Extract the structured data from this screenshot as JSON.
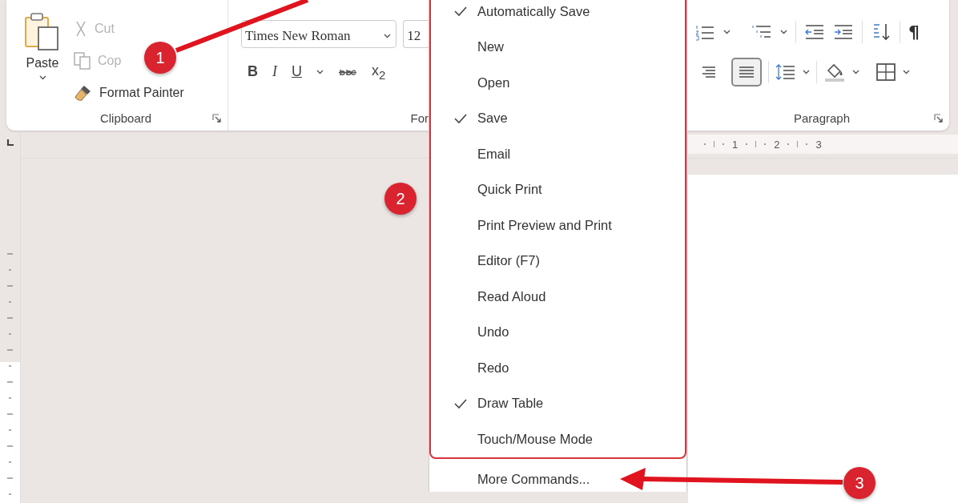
{
  "ribbon": {
    "clipboard": {
      "label": "Clipboard",
      "paste": {
        "label": "Paste"
      },
      "commands": [
        {
          "kind": "cut",
          "label": "Cut",
          "disabled": true
        },
        {
          "kind": "copy",
          "label": "Cop",
          "disabled": true
        },
        {
          "kind": "painter",
          "label": "Format Painter",
          "disabled": false
        }
      ]
    },
    "font": {
      "label": "For",
      "font_name": "Times New Roman",
      "font_size": "12",
      "buttons": [
        {
          "kind": "bold",
          "text": "B"
        },
        {
          "kind": "italic",
          "text": "I"
        },
        {
          "kind": "underline",
          "text": "U"
        },
        {
          "kind": "strike"
        },
        {
          "kind": "subscript",
          "text": "x$_{2}$"
        }
      ]
    },
    "paragraph": {
      "label": "Paragraph",
      "pilcrow": "¶",
      "alignment": [
        {
          "selected": false
        },
        {
          "selected": true
        }
      ]
    }
  },
  "ruler": {
    "marks": [
      "1",
      "2",
      "3"
    ]
  },
  "quick_access_menu": {
    "items": [
      {
        "label": "Automatically Save",
        "checked": true
      },
      {
        "label": "New",
        "checked": false
      },
      {
        "label": "Open",
        "checked": false
      },
      {
        "label": "Save",
        "checked": true
      },
      {
        "label": "Email",
        "checked": false
      },
      {
        "label": "Quick Print",
        "checked": false
      },
      {
        "label": "Print Preview and Print",
        "checked": false
      },
      {
        "label": "Editor (F7)",
        "checked": false
      },
      {
        "label": "Read Aloud",
        "checked": false
      },
      {
        "label": "Undo",
        "checked": false
      },
      {
        "label": "Redo",
        "checked": false
      },
      {
        "label": "Draw Table",
        "checked": true
      },
      {
        "label": "Touch/Mouse Mode",
        "checked": false
      }
    ],
    "more_commands": "More Commands..."
  },
  "callouts": [
    {
      "number": "1"
    },
    {
      "number": "2"
    },
    {
      "number": "3"
    }
  ]
}
